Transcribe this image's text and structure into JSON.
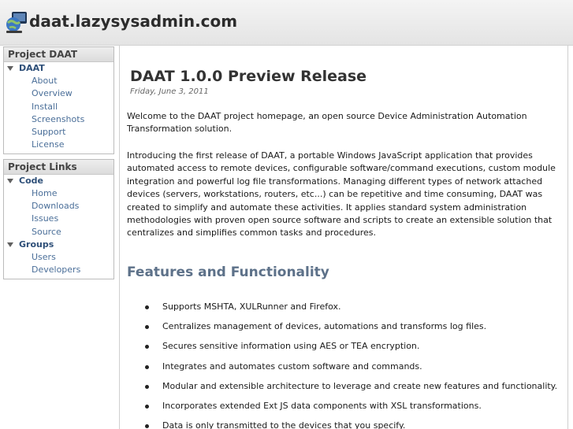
{
  "header": {
    "site_title": "daat.lazysysadmin.com",
    "logo_icon": "globe-computer-icon"
  },
  "sidebar": {
    "project_daat": {
      "title": "Project DAAT",
      "group_label": "DAAT",
      "links": [
        "About",
        "Overview",
        "Install",
        "Screenshots",
        "Support",
        "License"
      ]
    },
    "project_links": {
      "title": "Project Links",
      "groups": [
        {
          "label": "Code",
          "links": [
            "Home",
            "Downloads",
            "Issues",
            "Source"
          ]
        },
        {
          "label": "Groups",
          "links": [
            "Users",
            "Developers"
          ]
        }
      ]
    }
  },
  "main": {
    "post_title": "DAAT 1.0.0 Preview Release",
    "post_date": "Friday, June 3, 2011",
    "intro": "Welcome to the DAAT project homepage, an open source Device Administration Automation Transformation solution.",
    "body": "Introducing the first release of DAAT, a portable Windows JavaScript application that provides automated access to remote devices, configurable software/command executions, custom module integration and powerful log file transformations. Managing different types of network attached devices (servers, workstations, routers, etc...) can be repetitive and time consuming, DAAT was created to simplify and automate these activities. It applies standard system administration methodologies with proven open source software and scripts to create an extensible solution that centralizes and simplifies common tasks and procedures.",
    "features_heading": "Features and Functionality",
    "features": [
      "Supports MSHTA, XULRunner and Firefox.",
      "Centralizes management of devices, automations and transforms log files.",
      "Secures sensitive information using AES or TEA encryption.",
      "Integrates and automates custom software and commands.",
      "Modular and extensible architecture to leverage and create new features and functionality.",
      "Incorporates extended Ext JS data components with XSL transformations.",
      "Data is only transmitted to the devices that you specify."
    ]
  },
  "colors": {
    "link": "#4b6f99",
    "group_label": "#2e4f78",
    "section_heading": "#5d7189"
  }
}
